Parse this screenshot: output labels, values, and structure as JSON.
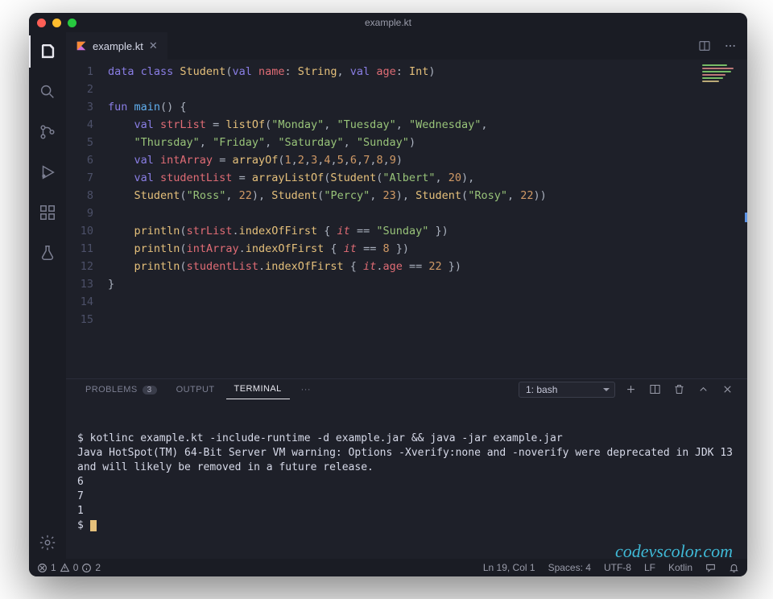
{
  "window_title": "example.kt",
  "tab": {
    "filename": "example.kt"
  },
  "editor": {
    "line_numbers": [
      "1",
      "2",
      "3",
      "4",
      "5",
      "6",
      "7",
      "8",
      "9",
      "10",
      "11",
      "12",
      "13",
      "14",
      "15"
    ],
    "tokens": [
      [
        [
          "kw",
          "data class "
        ],
        [
          "ty",
          "Student"
        ],
        [
          "pc",
          "("
        ],
        [
          "kw",
          "val "
        ],
        [
          "vr",
          "name"
        ],
        [
          "pc",
          ": "
        ],
        [
          "ty",
          "String"
        ],
        [
          "pc",
          ", "
        ],
        [
          "kw",
          "val "
        ],
        [
          "vr",
          "age"
        ],
        [
          "pc",
          ": "
        ],
        [
          "ty",
          "Int"
        ],
        [
          "pc",
          ")"
        ]
      ],
      [],
      [
        [
          "kw",
          "fun "
        ],
        [
          "fn",
          "main"
        ],
        [
          "pc",
          "() {"
        ]
      ],
      [
        [
          "pr",
          "    "
        ],
        [
          "kw",
          "val "
        ],
        [
          "vr",
          "strList"
        ],
        [
          "pc",
          " = "
        ],
        [
          "fnc",
          "listOf"
        ],
        [
          "pc",
          "("
        ],
        [
          "st",
          "\"Monday\""
        ],
        [
          "pc",
          ", "
        ],
        [
          "st",
          "\"Tuesday\""
        ],
        [
          "pc",
          ", "
        ],
        [
          "st",
          "\"Wednesday\""
        ],
        [
          "pc",
          ","
        ]
      ],
      [
        [
          "pr",
          "    "
        ],
        [
          "st",
          "\"Thursday\""
        ],
        [
          "pc",
          ", "
        ],
        [
          "st",
          "\"Friday\""
        ],
        [
          "pc",
          ", "
        ],
        [
          "st",
          "\"Saturday\""
        ],
        [
          "pc",
          ", "
        ],
        [
          "st",
          "\"Sunday\""
        ],
        [
          "pc",
          ")"
        ]
      ],
      [
        [
          "pr",
          "    "
        ],
        [
          "kw",
          "val "
        ],
        [
          "vr",
          "intArray"
        ],
        [
          "pc",
          " = "
        ],
        [
          "fnc",
          "arrayOf"
        ],
        [
          "pc",
          "("
        ],
        [
          "nm",
          "1"
        ],
        [
          "pc",
          ","
        ],
        [
          "nm",
          "2"
        ],
        [
          "pc",
          ","
        ],
        [
          "nm",
          "3"
        ],
        [
          "pc",
          ","
        ],
        [
          "nm",
          "4"
        ],
        [
          "pc",
          ","
        ],
        [
          "nm",
          "5"
        ],
        [
          "pc",
          ","
        ],
        [
          "nm",
          "6"
        ],
        [
          "pc",
          ","
        ],
        [
          "nm",
          "7"
        ],
        [
          "pc",
          ","
        ],
        [
          "nm",
          "8"
        ],
        [
          "pc",
          ","
        ],
        [
          "nm",
          "9"
        ],
        [
          "pc",
          ")"
        ]
      ],
      [
        [
          "pr",
          "    "
        ],
        [
          "kw",
          "val "
        ],
        [
          "vr",
          "studentList"
        ],
        [
          "pc",
          " = "
        ],
        [
          "fnc",
          "arrayListOf"
        ],
        [
          "pc",
          "("
        ],
        [
          "ty",
          "Student"
        ],
        [
          "pc",
          "("
        ],
        [
          "st",
          "\"Albert\""
        ],
        [
          "pc",
          ", "
        ],
        [
          "nm",
          "20"
        ],
        [
          "pc",
          "),"
        ]
      ],
      [
        [
          "pr",
          "    "
        ],
        [
          "ty",
          "Student"
        ],
        [
          "pc",
          "("
        ],
        [
          "st",
          "\"Ross\""
        ],
        [
          "pc",
          ", "
        ],
        [
          "nm",
          "22"
        ],
        [
          "pc",
          "), "
        ],
        [
          "ty",
          "Student"
        ],
        [
          "pc",
          "("
        ],
        [
          "st",
          "\"Percy\""
        ],
        [
          "pc",
          ", "
        ],
        [
          "nm",
          "23"
        ],
        [
          "pc",
          "), "
        ],
        [
          "ty",
          "Student"
        ],
        [
          "pc",
          "("
        ],
        [
          "st",
          "\"Rosy\""
        ],
        [
          "pc",
          ", "
        ],
        [
          "nm",
          "22"
        ],
        [
          "pc",
          "))"
        ]
      ],
      [],
      [
        [
          "pr",
          "    "
        ],
        [
          "fnc",
          "println"
        ],
        [
          "pc",
          "("
        ],
        [
          "vr",
          "strList"
        ],
        [
          "pc",
          "."
        ],
        [
          "fnc",
          "indexOfFirst"
        ],
        [
          "pc",
          " { "
        ],
        [
          "it",
          "it"
        ],
        [
          "pc",
          " == "
        ],
        [
          "st",
          "\"Sunday\""
        ],
        [
          "pc",
          " })"
        ]
      ],
      [
        [
          "pr",
          "    "
        ],
        [
          "fnc",
          "println"
        ],
        [
          "pc",
          "("
        ],
        [
          "vr",
          "intArray"
        ],
        [
          "pc",
          "."
        ],
        [
          "fnc",
          "indexOfFirst"
        ],
        [
          "pc",
          " { "
        ],
        [
          "it",
          "it"
        ],
        [
          "pc",
          " == "
        ],
        [
          "nm",
          "8"
        ],
        [
          "pc",
          " })"
        ]
      ],
      [
        [
          "pr",
          "    "
        ],
        [
          "fnc",
          "println"
        ],
        [
          "pc",
          "("
        ],
        [
          "vr",
          "studentList"
        ],
        [
          "pc",
          "."
        ],
        [
          "fnc",
          "indexOfFirst"
        ],
        [
          "pc",
          " { "
        ],
        [
          "it",
          "it"
        ],
        [
          "pc",
          "."
        ],
        [
          "vr",
          "age"
        ],
        [
          "pc",
          " == "
        ],
        [
          "nm",
          "22"
        ],
        [
          "pc",
          " })"
        ]
      ],
      [
        [
          "pc",
          "}"
        ]
      ],
      [],
      []
    ]
  },
  "panel": {
    "tabs": {
      "problems": "PROBLEMS",
      "problems_count": "3",
      "output": "OUTPUT",
      "terminal": "TERMINAL"
    },
    "dropdown": "1: bash"
  },
  "terminal": {
    "lines": [
      "$ kotlinc example.kt -include-runtime -d example.jar && java -jar example.jar",
      "Java HotSpot(TM) 64-Bit Server VM warning: Options -Xverify:none and -noverify were deprecated in JDK 13 and will likely be removed in a future release.",
      "6",
      "7",
      "1",
      "$ "
    ]
  },
  "watermark": "codevscolor.com",
  "status": {
    "errors": "1",
    "warnings": "0",
    "info": "2",
    "cursor": "Ln 19, Col 1",
    "spaces": "Spaces: 4",
    "encoding": "UTF-8",
    "eol": "LF",
    "language": "Kotlin"
  }
}
